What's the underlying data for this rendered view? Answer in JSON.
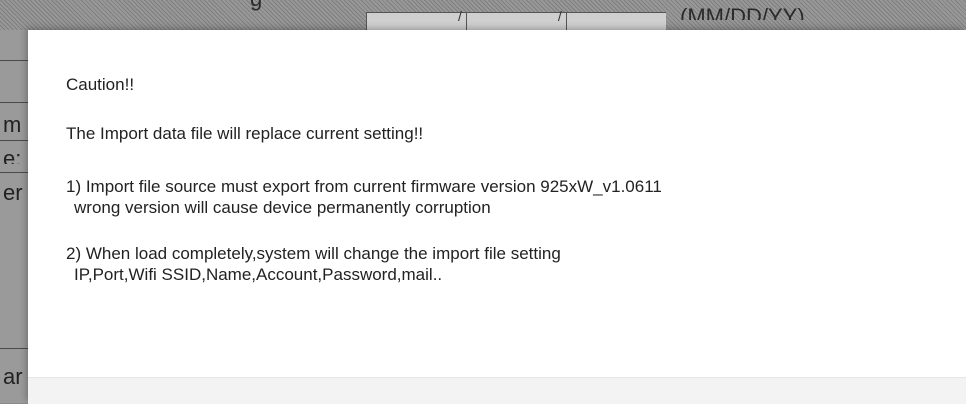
{
  "background": {
    "title_fragment": "g",
    "date_separator_1": "/",
    "date_separator_2": "/",
    "date_format": "(MM/DD/YY)",
    "left_fragments": [
      "m",
      "e:",
      "er",
      "ar"
    ]
  },
  "dialog": {
    "title": "Caution!!",
    "warning": "The Import data file will replace current setting!!",
    "item1_line1": "1) Import file source must export from current firmware version 925xW_v1.0611",
    "item1_line2": "wrong version will cause device permanently corruption",
    "item2_line1": "2) When load completely,system will change the import file setting",
    "item2_line2": "IP,Port,Wifi SSID,Name,Account,Password,mail.."
  }
}
